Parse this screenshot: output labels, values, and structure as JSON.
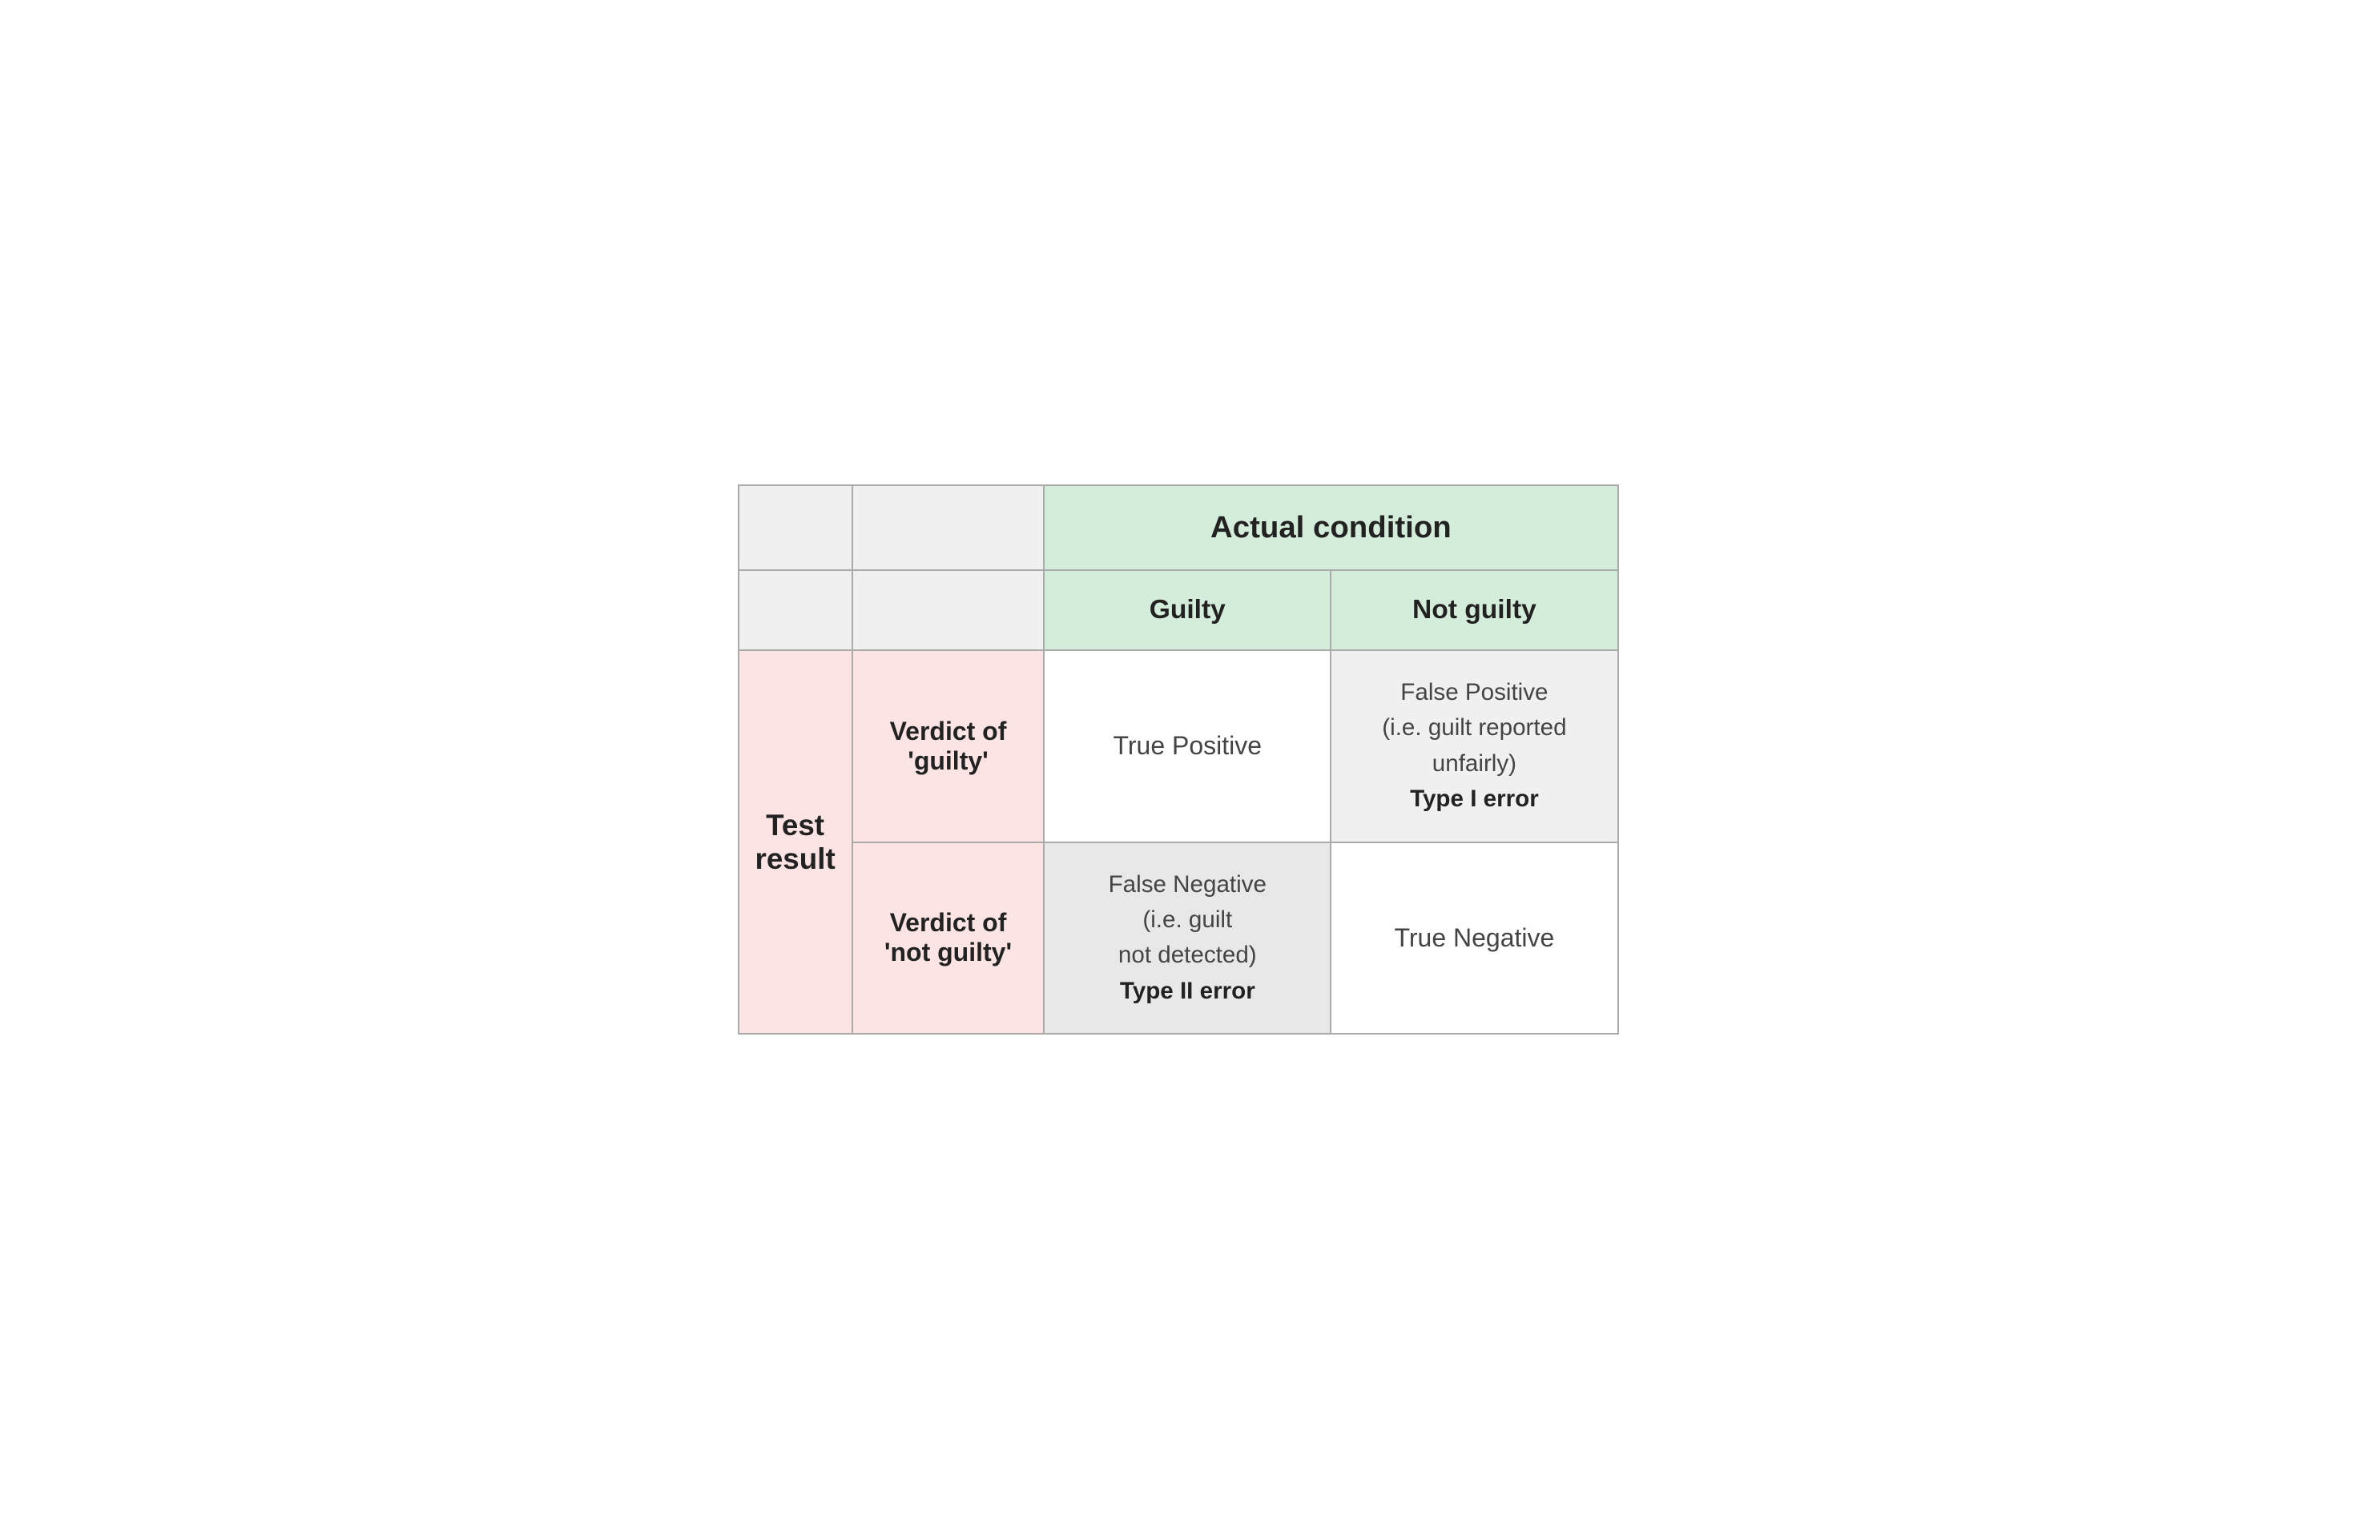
{
  "header": {
    "actual_condition_label": "Actual condition",
    "guilty_label": "Guilty",
    "not_guilty_label": "Not guilty"
  },
  "row_labels": {
    "test_result": "Test result",
    "verdict_guilty": "Verdict of 'guilty'",
    "verdict_not_guilty": "Verdict of 'not guilty'"
  },
  "cells": {
    "true_positive": "True Positive",
    "false_positive_desc": "False Positive\n(i.e. guilt reported unfairly)",
    "false_positive_error": "Type I error",
    "false_negative_desc": "False Negative\n(i.e. guilt not detected)",
    "false_negative_error": "Type II error",
    "true_negative": "True Negative"
  },
  "colors": {
    "green_header_bg": "#d4edda",
    "red_row_bg": "#fce4e4",
    "light_gray_bg": "#f0f0f0",
    "medium_gray_bg": "#e8e8e8",
    "white": "#ffffff",
    "border": "#aaa"
  }
}
